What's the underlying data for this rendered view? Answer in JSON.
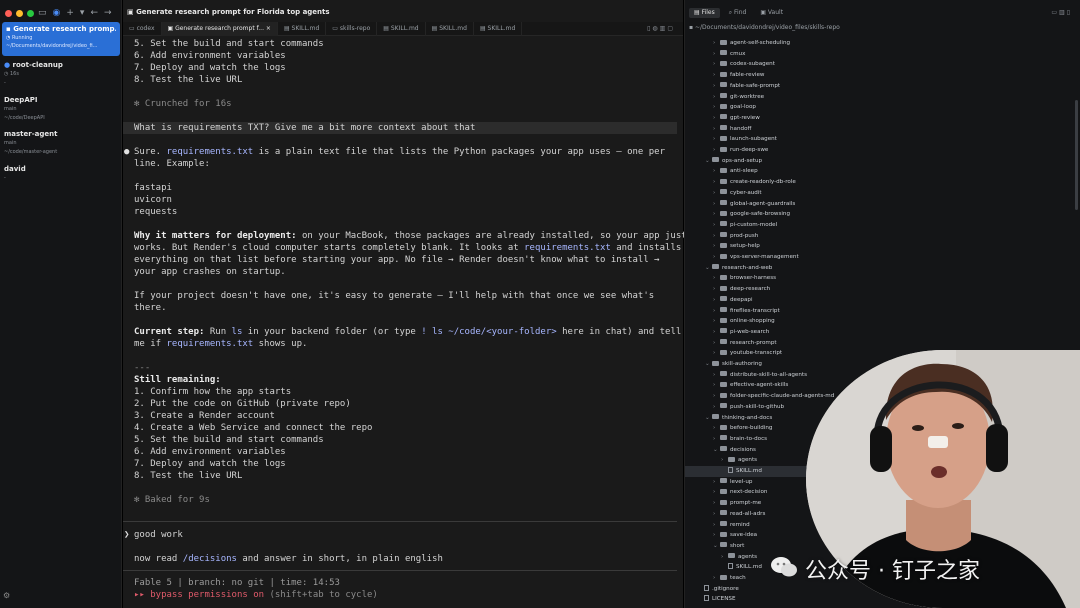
{
  "colors": {
    "accent": "#2a6fd6",
    "red": "#ff5f57",
    "yellow": "#febc2e",
    "green": "#28c840",
    "bypass": "#e05a6a",
    "link": "#a7b6ff"
  },
  "sidebar": {
    "active": {
      "title": "Generate research promp...",
      "status": "Running",
      "path": "~/Documents/davidondrej/video_fi..."
    },
    "items": [
      {
        "title": "root-cleanup",
        "sub1": "16s",
        "sub2": "-"
      },
      {
        "title": "DeepAPI",
        "sub1": "main",
        "sub2": "~/code/DeepAPI"
      },
      {
        "title": "master-agent",
        "sub1": "main",
        "sub2": "~/code/master-agent"
      },
      {
        "title": "david",
        "sub1": "-",
        "sub2": ""
      }
    ]
  },
  "center": {
    "window_title": "Generate research prompt for Florida top agents",
    "tabs": [
      "codex",
      "Generate research prompt f...",
      "SKILL.md",
      "skills-repo",
      "SKILL.md",
      "SKILL.md",
      "SKILL.md"
    ],
    "lines_top": [
      "5. Set the build and start commands",
      "6. Add environment variables",
      "7. Deploy and watch the logs",
      "8. Test the live URL"
    ],
    "crunched": "Crunched for 16s",
    "user_question": "What is requirements TXT? Give me a bit more context about that",
    "answer": {
      "p1a": "Sure. ",
      "p1_link": "requirements.txt",
      "p1b": " is a plain text file that lists the Python packages your app uses — one per",
      "p1c": "line. Example:",
      "packages": [
        "fastapi",
        "uvicorn",
        "requests"
      ],
      "why_bold": "Why it matters for deployment:",
      "why_1": " on your MacBook, those packages are already installed, so your app just",
      "why_2a": "works. But Render's cloud computer starts completely blank. It looks at ",
      "why_2_link": "requirements.txt",
      "why_2b": " and installs",
      "why_3": "everything on that list before starting your app. No file → Render doesn't know what to install →",
      "why_4": "your app crashes on startup.",
      "gen_1": "If your project doesn't have one, it's easy to generate — I'll help with that once we see what's",
      "gen_2": "there.",
      "cur_bold": "Current step:",
      "cur_1a": " Run ",
      "cur_1_link": "ls",
      "cur_1b": " in your backend folder (or type ",
      "cur_1_link2": "! ls ~/code/<your-folder>",
      "cur_1c": " here in chat) and tell",
      "cur_2a": "me if ",
      "cur_2_link": "requirements.txt",
      "cur_2b": " shows up.",
      "divider": "---",
      "remaining": "Still remaining:",
      "steps": [
        "1. Confirm how the app starts",
        "2. Put the code on GitHub (private repo)",
        "3. Create a Render account",
        "4. Create a Web Service and connect the repo",
        "5. Set the build and start commands",
        "6. Add environment variables",
        "7. Deploy and watch the logs",
        "8. Test the live URL"
      ]
    },
    "baked": "Baked for 9s",
    "input_1": "good work",
    "input_2a": "now read ",
    "input_2_link": "/decisions",
    "input_2b": " and answer in short, in plain english",
    "status_line": "Fable 5 | branch: no git | time: 14:53",
    "bypass_a": "▸▸ bypass permissions on",
    "bypass_b": " (shift+tab to cycle)"
  },
  "right": {
    "tabs": [
      "Files",
      "Find",
      "Vault"
    ],
    "path": "~/Documents/davidondrej/video_files/skills-repo",
    "tree": [
      {
        "label": "agent-self-scheduling",
        "depth": 2,
        "type": "folder",
        "open": false
      },
      {
        "label": "cmux",
        "depth": 2,
        "type": "folder",
        "open": false
      },
      {
        "label": "codex-subagent",
        "depth": 2,
        "type": "folder",
        "open": false
      },
      {
        "label": "fable-review",
        "depth": 2,
        "type": "folder",
        "open": false
      },
      {
        "label": "fable-safe-prompt",
        "depth": 2,
        "type": "folder",
        "open": false
      },
      {
        "label": "git-worktree",
        "depth": 2,
        "type": "folder",
        "open": false
      },
      {
        "label": "goal-loop",
        "depth": 2,
        "type": "folder",
        "open": false
      },
      {
        "label": "gpt-review",
        "depth": 2,
        "type": "folder",
        "open": false
      },
      {
        "label": "handoff",
        "depth": 2,
        "type": "folder",
        "open": false
      },
      {
        "label": "launch-subagent",
        "depth": 2,
        "type": "folder",
        "open": false
      },
      {
        "label": "run-deep-swe",
        "depth": 2,
        "type": "folder",
        "open": false
      },
      {
        "label": "ops-and-setup",
        "depth": 1,
        "type": "folder",
        "open": true
      },
      {
        "label": "anti-sleep",
        "depth": 2,
        "type": "folder",
        "open": false
      },
      {
        "label": "create-readonly-db-role",
        "depth": 2,
        "type": "folder",
        "open": false
      },
      {
        "label": "cyber-audit",
        "depth": 2,
        "type": "folder",
        "open": false
      },
      {
        "label": "global-agent-guardrails",
        "depth": 2,
        "type": "folder",
        "open": false
      },
      {
        "label": "google-safe-browsing",
        "depth": 2,
        "type": "folder",
        "open": false
      },
      {
        "label": "pi-custom-model",
        "depth": 2,
        "type": "folder",
        "open": false
      },
      {
        "label": "prod-push",
        "depth": 2,
        "type": "folder",
        "open": false
      },
      {
        "label": "setup-help",
        "depth": 2,
        "type": "folder",
        "open": false
      },
      {
        "label": "vps-server-management",
        "depth": 2,
        "type": "folder",
        "open": false
      },
      {
        "label": "research-and-web",
        "depth": 1,
        "type": "folder",
        "open": true
      },
      {
        "label": "browser-harness",
        "depth": 2,
        "type": "folder",
        "open": false
      },
      {
        "label": "deep-research",
        "depth": 2,
        "type": "folder",
        "open": false
      },
      {
        "label": "deepapi",
        "depth": 2,
        "type": "folder",
        "open": false
      },
      {
        "label": "fireflies-transcript",
        "depth": 2,
        "type": "folder",
        "open": false
      },
      {
        "label": "online-shopping",
        "depth": 2,
        "type": "folder",
        "open": false
      },
      {
        "label": "pi-web-search",
        "depth": 2,
        "type": "folder",
        "open": false
      },
      {
        "label": "research-prompt",
        "depth": 2,
        "type": "folder",
        "open": false
      },
      {
        "label": "youtube-transcript",
        "depth": 2,
        "type": "folder",
        "open": false
      },
      {
        "label": "skill-authoring",
        "depth": 1,
        "type": "folder",
        "open": true
      },
      {
        "label": "distribute-skill-to-all-agents",
        "depth": 2,
        "type": "folder",
        "open": false
      },
      {
        "label": "effective-agent-skills",
        "depth": 2,
        "type": "folder",
        "open": false
      },
      {
        "label": "folder-specific-claude-and-agents-md",
        "depth": 2,
        "type": "folder",
        "open": false
      },
      {
        "label": "push-skill-to-github",
        "depth": 2,
        "type": "folder",
        "open": false
      },
      {
        "label": "thinking-and-docs",
        "depth": 1,
        "type": "folder",
        "open": true
      },
      {
        "label": "before-building",
        "depth": 2,
        "type": "folder",
        "open": false
      },
      {
        "label": "brain-to-docs",
        "depth": 2,
        "type": "folder",
        "open": false
      },
      {
        "label": "decisions",
        "depth": 2,
        "type": "folder",
        "open": true
      },
      {
        "label": "agents",
        "depth": 3,
        "type": "folder",
        "open": false
      },
      {
        "label": "SKILL.md",
        "depth": 3,
        "type": "file",
        "selected": true
      },
      {
        "label": "level-up",
        "depth": 2,
        "type": "folder",
        "open": false
      },
      {
        "label": "next-decision",
        "depth": 2,
        "type": "folder",
        "open": false
      },
      {
        "label": "prompt-me",
        "depth": 2,
        "type": "folder",
        "open": false
      },
      {
        "label": "read-all-adrs",
        "depth": 2,
        "type": "folder",
        "open": false
      },
      {
        "label": "remind",
        "depth": 2,
        "type": "folder",
        "open": false
      },
      {
        "label": "save-idea",
        "depth": 2,
        "type": "folder",
        "open": false
      },
      {
        "label": "short",
        "depth": 2,
        "type": "folder",
        "open": true
      },
      {
        "label": "agents",
        "depth": 3,
        "type": "folder",
        "open": false
      },
      {
        "label": "SKILL.md",
        "depth": 3,
        "type": "file"
      },
      {
        "label": "teach",
        "depth": 2,
        "type": "folder",
        "open": false
      },
      {
        "label": ".gitignore",
        "depth": 0,
        "type": "file"
      },
      {
        "label": "LICENSE",
        "depth": 0,
        "type": "file"
      }
    ]
  },
  "watermark": "公众号 · 钉子之家"
}
